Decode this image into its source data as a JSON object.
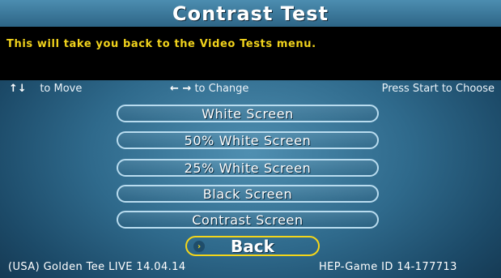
{
  "header": {
    "title": "Contrast Test"
  },
  "info": {
    "message": "This will take you back to the Video Tests menu."
  },
  "help": {
    "move_icon": "up-down-arrows-icon",
    "move_arrows": "↑↓",
    "move_text": "to Move",
    "change_icon": "left-right-arrows-icon",
    "change_arrows": "← →",
    "change_text": "to Change",
    "choose_text": "Press Start to Choose"
  },
  "menu": {
    "items": [
      {
        "label": "White Screen"
      },
      {
        "label": "50% White Screen"
      },
      {
        "label": "25% White Screen"
      },
      {
        "label": "Black Screen"
      },
      {
        "label": "Contrast Screen"
      }
    ],
    "back": {
      "label": "Back",
      "selected": true,
      "pointer_icon": "chevron-right-icon",
      "pointer_glyph": "›"
    }
  },
  "footer": {
    "version": "(USA) Golden Tee LIVE 14.04.14",
    "game_id": "HEP-Game ID 14-177713"
  },
  "colors": {
    "highlight": "#f4d61a",
    "info_text": "#f0d21c",
    "button_border": "#b9dcef",
    "background": "#2f6a8c"
  }
}
